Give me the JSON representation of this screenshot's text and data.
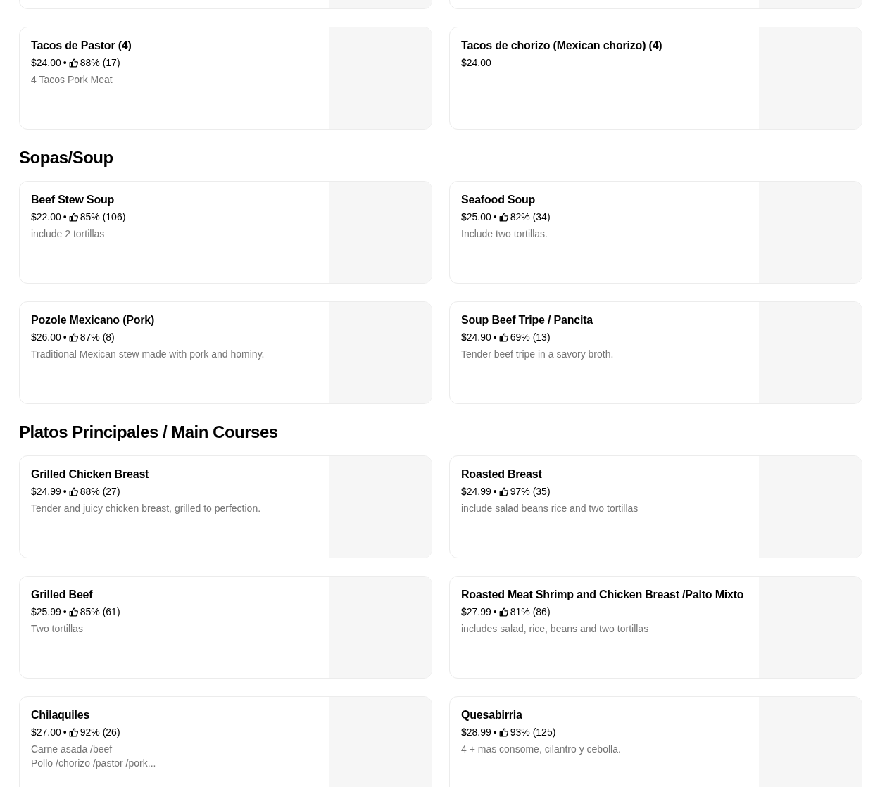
{
  "sections": [
    {
      "items": [
        {
          "cut_off": true
        },
        {
          "cut_off": true
        },
        {
          "name": "Tacos de Pastor (4)",
          "price": "$24.00",
          "separator": "•",
          "rating": "88% (17)",
          "description": "4 Tacos Pork Meat"
        },
        {
          "name": "Tacos de chorizo (Mexican chorizo) (4)",
          "price": "$24.00"
        }
      ]
    },
    {
      "title": "Sopas/Soup",
      "items": [
        {
          "name": "Beef Stew Soup",
          "price": "$22.00",
          "separator": "•",
          "rating": "85% (106)",
          "description": "include 2 tortillas"
        },
        {
          "name": "Seafood Soup",
          "price": "$25.00",
          "separator": "•",
          "rating": "82% (34)",
          "description": "Include two tortillas."
        },
        {
          "name": "Pozole Mexicano  (Pork)",
          "price": "$26.00",
          "separator": "•",
          "rating": "87% (8)",
          "description": "Traditional Mexican stew made with pork and hominy."
        },
        {
          "name": "Soup Beef Tripe / Pancita",
          "price": "$24.90",
          "separator": "•",
          "rating": "69% (13)",
          "description": "Tender beef tripe in a savory broth."
        }
      ]
    },
    {
      "title": "Platos Principales / Main Courses",
      "items": [
        {
          "name": "Grilled Chicken Breast",
          "price": "$24.99",
          "separator": "•",
          "rating": "88% (27)",
          "description": "Tender and juicy chicken breast, grilled to perfection."
        },
        {
          "name": "Roasted Breast",
          "price": "$24.99",
          "separator": "•",
          "rating": "97% (35)",
          "description": "include salad beans rice and two tortillas"
        },
        {
          "name": "Grilled Beef",
          "price": "$25.99",
          "separator": "•",
          "rating": "85% (61)",
          "description": "Two tortillas"
        },
        {
          "name": "Roasted Meat Shrimp and Chicken Breast /Palto Mixto",
          "price": "$27.99",
          "separator": "•",
          "rating": "81% (86)",
          "description": "includes salad, rice, beans and two tortillas"
        },
        {
          "name": "Chilaquiles",
          "price": "$27.00",
          "separator": "•",
          "rating": "92% (26)",
          "description": "Carne asada /beef\nPollo /chorizo /pastor /pork..."
        },
        {
          "name": "Quesabirria",
          "price": "$28.99",
          "separator": "•",
          "rating": "93% (125)",
          "description": "4 + mas consome, cilantro y cebolla."
        }
      ]
    }
  ]
}
